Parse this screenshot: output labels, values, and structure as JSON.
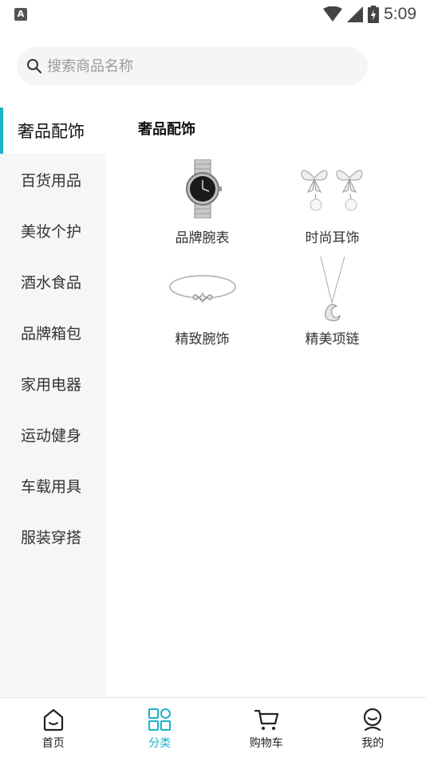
{
  "status_bar": {
    "time": "5:09",
    "notification_letter": "A"
  },
  "search": {
    "placeholder": "搜索商品名称"
  },
  "sidebar": {
    "items": [
      {
        "label": "奢品配饰",
        "active": true
      },
      {
        "label": "百货用品",
        "active": false
      },
      {
        "label": "美妆个护",
        "active": false
      },
      {
        "label": "酒水食品",
        "active": false
      },
      {
        "label": "品牌箱包",
        "active": false
      },
      {
        "label": "家用电器",
        "active": false
      },
      {
        "label": "运动健身",
        "active": false
      },
      {
        "label": "车载用具",
        "active": false
      },
      {
        "label": "服装穿搭",
        "active": false
      }
    ]
  },
  "content": {
    "title": "奢品配饰",
    "products": [
      {
        "label": "品牌腕表",
        "icon": "watch-image"
      },
      {
        "label": "时尚耳饰",
        "icon": "earrings-image"
      },
      {
        "label": "精致腕饰",
        "icon": "bracelet-image"
      },
      {
        "label": "精美项链",
        "icon": "necklace-image"
      }
    ]
  },
  "bottom_nav": {
    "accent_color": "#1bb3c7",
    "items": [
      {
        "label": "首页",
        "icon": "home-icon",
        "active": false
      },
      {
        "label": "分类",
        "icon": "category-icon",
        "active": true
      },
      {
        "label": "购物车",
        "icon": "cart-icon",
        "active": false
      },
      {
        "label": "我的",
        "icon": "profile-icon",
        "active": false
      }
    ]
  }
}
